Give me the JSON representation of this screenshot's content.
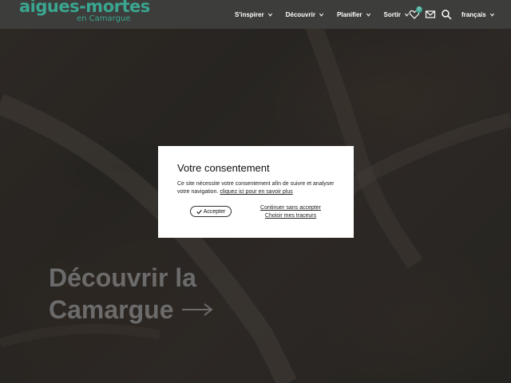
{
  "header": {
    "logo_main": "aigues-mortes",
    "logo_sub": "en Camargue",
    "nav": [
      {
        "label": "S'inspirer"
      },
      {
        "label": "Découvrir"
      },
      {
        "label": "Planifier"
      },
      {
        "label": "Sortir"
      }
    ],
    "favorites_count": "0",
    "language": "français"
  },
  "hero": {
    "title_line1": "Découvrir la",
    "title_line2": "Camargue"
  },
  "consent": {
    "title": "Votre consentement",
    "text": "Ce site nécessite votre consentement afin de suivre et analyser votre navigation.",
    "more_link": "cliquez ici pour en savoir plus",
    "accept_label": "Accepter",
    "continue_label": "Continuer sans accepter",
    "choose_label": "Choisir mes traceurs"
  },
  "colors": {
    "brand": "#3aa690",
    "header_bg": "#3d3d3b"
  }
}
